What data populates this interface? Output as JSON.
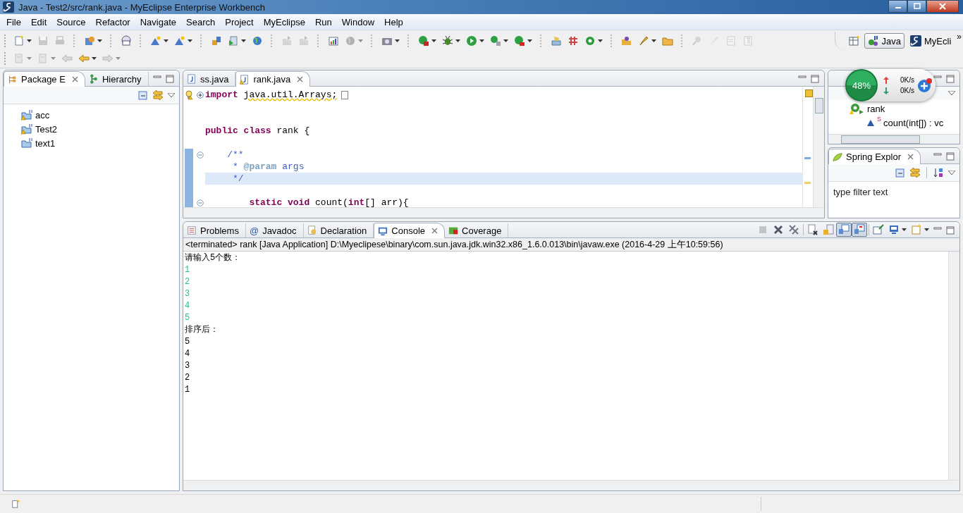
{
  "window": {
    "title": "Java - Test2/src/rank.java - MyEclipse Enterprise Workbench"
  },
  "menu": [
    "File",
    "Edit",
    "Source",
    "Refactor",
    "Navigate",
    "Search",
    "Project",
    "MyEclipse",
    "Run",
    "Window",
    "Help"
  ],
  "toolbar": {
    "rows": [
      [
        {
          "kind": "document",
          "disabled": false,
          "dropdown": true
        },
        {
          "kind": "disk",
          "disabled": true,
          "dropdown": false
        },
        {
          "kind": "printer",
          "disabled": true,
          "dropdown": false
        },
        {
          "kind": "separator"
        },
        {
          "kind": "box",
          "disabled": false,
          "dropdown": true
        },
        {
          "kind": "separator"
        },
        {
          "kind": "badge",
          "disabled": false,
          "dropdown": false
        },
        {
          "kind": "separator"
        },
        {
          "kind": "mountain",
          "disabled": false,
          "dropdown": true
        },
        {
          "kind": "mountain",
          "disabled": false,
          "dropdown": true
        },
        {
          "kind": "separator"
        },
        {
          "kind": "deploy",
          "disabled": false,
          "dropdown": false
        },
        {
          "kind": "play-page",
          "disabled": false,
          "dropdown": true
        },
        {
          "kind": "globe",
          "disabled": false,
          "dropdown": false
        },
        {
          "kind": "separator"
        },
        {
          "kind": "folder-arrow",
          "disabled": true,
          "dropdown": false
        },
        {
          "kind": "folder-arrow",
          "disabled": true,
          "dropdown": false
        },
        {
          "kind": "separator"
        },
        {
          "kind": "chart",
          "disabled": false,
          "dropdown": false
        },
        {
          "kind": "globe",
          "disabled": true,
          "dropdown": true
        },
        {
          "kind": "separator"
        },
        {
          "kind": "camera",
          "disabled": false,
          "dropdown": true
        },
        {
          "kind": "separator"
        },
        {
          "kind": "server",
          "disabled": false,
          "dropdown": true
        },
        {
          "kind": "bug",
          "disabled": false,
          "dropdown": true
        },
        {
          "kind": "play",
          "disabled": false,
          "dropdown": true
        },
        {
          "kind": "play-list",
          "disabled": false,
          "dropdown": true
        },
        {
          "kind": "play-stop",
          "disabled": false,
          "dropdown": true
        },
        {
          "kind": "separator"
        },
        {
          "kind": "package",
          "disabled": false,
          "dropdown": false
        },
        {
          "kind": "grid",
          "disabled": false,
          "dropdown": false
        },
        {
          "kind": "class-circle",
          "disabled": false,
          "dropdown": true
        },
        {
          "kind": "separator"
        },
        {
          "kind": "open-folder",
          "disabled": false,
          "dropdown": false
        },
        {
          "kind": "brush",
          "disabled": false,
          "dropdown": true
        },
        {
          "kind": "folder",
          "disabled": false,
          "dropdown": false
        },
        {
          "kind": "separator"
        },
        {
          "kind": "pin",
          "disabled": true,
          "dropdown": false
        },
        {
          "kind": "pen",
          "disabled": true,
          "dropdown": false
        },
        {
          "kind": "note",
          "disabled": true,
          "dropdown": false
        },
        {
          "kind": "pilcrow",
          "disabled": true,
          "dropdown": false
        }
      ],
      [
        {
          "kind": "page",
          "disabled": true,
          "dropdown": true
        },
        {
          "kind": "page",
          "disabled": true,
          "dropdown": true
        },
        {
          "kind": "arrow-left",
          "disabled": true,
          "dropdown": false
        },
        {
          "kind": "arrow-left",
          "disabled": false,
          "dropdown": true
        },
        {
          "kind": "arrow-right",
          "disabled": true,
          "dropdown": true
        }
      ]
    ]
  },
  "perspectives": {
    "items": [
      {
        "label": "Java",
        "selected": true
      },
      {
        "label": "MyEcli",
        "selected": false
      }
    ],
    "more": "»"
  },
  "package_explorer": {
    "tabs": [
      {
        "label": "Package E",
        "selected": true
      },
      {
        "label": "Hierarchy",
        "selected": false
      }
    ],
    "projects": [
      {
        "name": "acc",
        "warning": true
      },
      {
        "name": "Test2",
        "warning": true
      },
      {
        "name": "text1",
        "warning": false
      }
    ]
  },
  "editor": {
    "tabs": [
      {
        "label": "ss.java",
        "selected": false,
        "warning": false
      },
      {
        "label": "rank.java",
        "selected": true,
        "warning": true
      }
    ],
    "lines": [
      {
        "tokens": [
          {
            "kind": "keyword",
            "text": "import "
          },
          {
            "kind": "warning",
            "text": "java.util.Arrays;"
          }
        ],
        "foldable": true,
        "collapsed": true,
        "warning": true,
        "current": false,
        "in_range": false
      },
      {
        "current": false,
        "in_range": false
      },
      {
        "current": false,
        "in_range": false
      },
      {
        "tokens": [
          {
            "kind": "keyword",
            "text": "public"
          },
          {
            "kind": "keyword",
            "text": " class"
          },
          {
            "kind": "plain",
            "text": " rank {"
          }
        ],
        "current": false,
        "in_range": false
      },
      {
        "current": false,
        "in_range": false
      },
      {
        "tokens": [
          {
            "kind": "comment",
            "text": "    /**"
          }
        ],
        "foldable": true,
        "collapsed": false,
        "current": false,
        "in_range": true
      },
      {
        "tokens": [
          {
            "kind": "comment",
            "text": "     * "
          },
          {
            "kind": "doctag",
            "text": "@param"
          },
          {
            "kind": "comment",
            "text": " args"
          }
        ],
        "current": false,
        "in_range": true
      },
      {
        "tokens": [
          {
            "kind": "comment",
            "text": "     */"
          }
        ],
        "current": true,
        "in_range": true
      },
      {
        "current": false,
        "in_range": true
      },
      {
        "tokens": [
          {
            "kind": "keyword",
            "text": "        static"
          },
          {
            "kind": "keyword",
            "text": " void"
          },
          {
            "kind": "plain",
            "text": " count("
          },
          {
            "kind": "keyword",
            "text": "int"
          },
          {
            "kind": "plain",
            "text": "[] arr){"
          }
        ],
        "foldable": true,
        "collapsed": false,
        "current": false,
        "in_range": true
      }
    ]
  },
  "outline": {
    "items": [
      {
        "label": "rank",
        "children": [
          {
            "label": "count(int[]) : vc",
            "static_mark": "S"
          }
        ]
      }
    ]
  },
  "spring_explorer": {
    "tab": "Spring Explor",
    "filter": {
      "placeholder": "type filter text"
    }
  },
  "speed_widget": {
    "percent": "48%",
    "upload": "0K/s",
    "download": "0K/s"
  },
  "console": {
    "tabs": [
      {
        "label": "Problems",
        "selected": false,
        "kind": "problems"
      },
      {
        "label": "Javadoc",
        "selected": false,
        "kind": "javadoc",
        "icon_char": "@"
      },
      {
        "label": "Declaration",
        "selected": false,
        "kind": "declaration"
      },
      {
        "label": "Console",
        "selected": true,
        "kind": "console"
      },
      {
        "label": "Coverage",
        "selected": false,
        "kind": "coverage"
      }
    ],
    "toolbar": [
      {
        "kind": "stop-square",
        "disabled": true,
        "pressed": false,
        "dropdown": false
      },
      {
        "kind": "x-mark",
        "disabled": false,
        "pressed": false,
        "dropdown": false
      },
      {
        "kind": "double-x",
        "disabled": false,
        "pressed": false,
        "dropdown": false
      },
      {
        "kind": "separator"
      },
      {
        "kind": "clear-page",
        "disabled": false,
        "pressed": false,
        "dropdown": false
      },
      {
        "kind": "lock-page",
        "disabled": false,
        "pressed": false,
        "dropdown": false
      },
      {
        "kind": "console-out",
        "disabled": false,
        "pressed": true,
        "dropdown": false
      },
      {
        "kind": "console-err",
        "disabled": false,
        "pressed": true,
        "dropdown": false
      },
      {
        "kind": "separator"
      },
      {
        "kind": "pin-window",
        "disabled": false,
        "pressed": false,
        "dropdown": false
      },
      {
        "kind": "monitor",
        "disabled": false,
        "pressed": false,
        "dropdown": true
      },
      {
        "kind": "new-window",
        "disabled": false,
        "pressed": false,
        "dropdown": true
      }
    ],
    "header": "<terminated> rank [Java Application] D:\\Myeclipese\\binary\\com.sun.java.jdk.win32.x86_1.6.0.013\\bin\\javaw.exe (2016-4-29 上午10:59:56)",
    "lines": [
      {
        "text": "请输入5个数：",
        "kind": "output"
      },
      {
        "text": "1",
        "kind": "input"
      },
      {
        "text": "2",
        "kind": "input"
      },
      {
        "text": "3",
        "kind": "input"
      },
      {
        "text": "4",
        "kind": "input"
      },
      {
        "text": "5",
        "kind": "input"
      },
      {
        "text": "排序后：",
        "kind": "output"
      },
      {
        "text": "5",
        "kind": "output"
      },
      {
        "text": "4",
        "kind": "output"
      },
      {
        "text": "3",
        "kind": "output"
      },
      {
        "text": "2",
        "kind": "output"
      },
      {
        "text": "1",
        "kind": "output"
      }
    ]
  }
}
